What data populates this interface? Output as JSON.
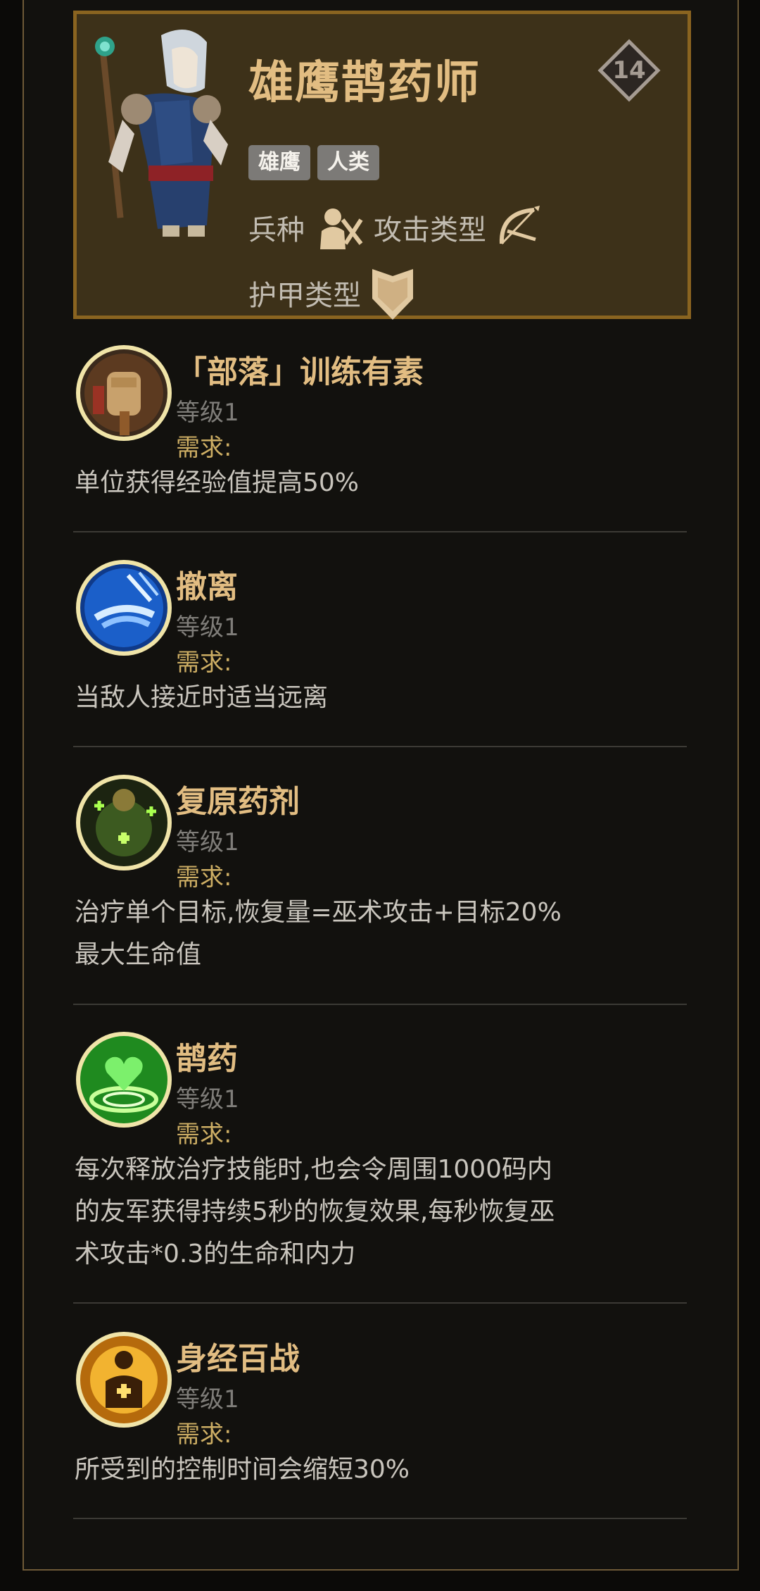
{
  "unit": {
    "name": "雄鹰鹊药师",
    "level": "14",
    "tags": [
      "雄鹰",
      "人类"
    ],
    "troop_label": "兵种",
    "attack_type_label": "攻击类型",
    "armor_type_label": "护甲类型",
    "icons": {
      "portrait": "healer-portrait",
      "troop": "infantry-icon",
      "attack": "bow-icon",
      "armor": "shield-icon",
      "level": "diamond-badge-icon"
    }
  },
  "skills": [
    {
      "name": "「部落」训练有素",
      "level": "等级1",
      "requirement": "需求:",
      "description": [
        "单位获得经验值提高50%"
      ],
      "icon": "gauntlet-fist-icon"
    },
    {
      "name": "撤离",
      "level": "等级1",
      "requirement": "需求:",
      "description": [
        "当敌人接近时适当远离"
      ],
      "icon": "blue-dash-icon"
    },
    {
      "name": "复原药剂",
      "level": "等级1",
      "requirement": "需求:",
      "description": [
        "治疗单个目标,恢复量=巫术攻击+目标20%",
        "最大生命值"
      ],
      "icon": "green-potion-heal-icon"
    },
    {
      "name": "鹊药",
      "level": "等级1",
      "requirement": "需求:",
      "description": [
        "每次释放治疗技能时,也会令周围1000码内",
        "的友军获得持续5秒的恢复效果,每秒恢复巫",
        "术攻击*0.3的生命和内力"
      ],
      "icon": "green-heart-aura-icon"
    },
    {
      "name": "身经百战",
      "level": "等级1",
      "requirement": "需求:",
      "description": [
        "所受到的控制时间会缩短30%"
      ],
      "icon": "golden-cross-figure-icon"
    }
  ],
  "colors": {
    "accent_gold": "#e2bd82",
    "card_border": "#8a6420",
    "card_bg": "#3d3119",
    "requirement": "#cdae64"
  }
}
